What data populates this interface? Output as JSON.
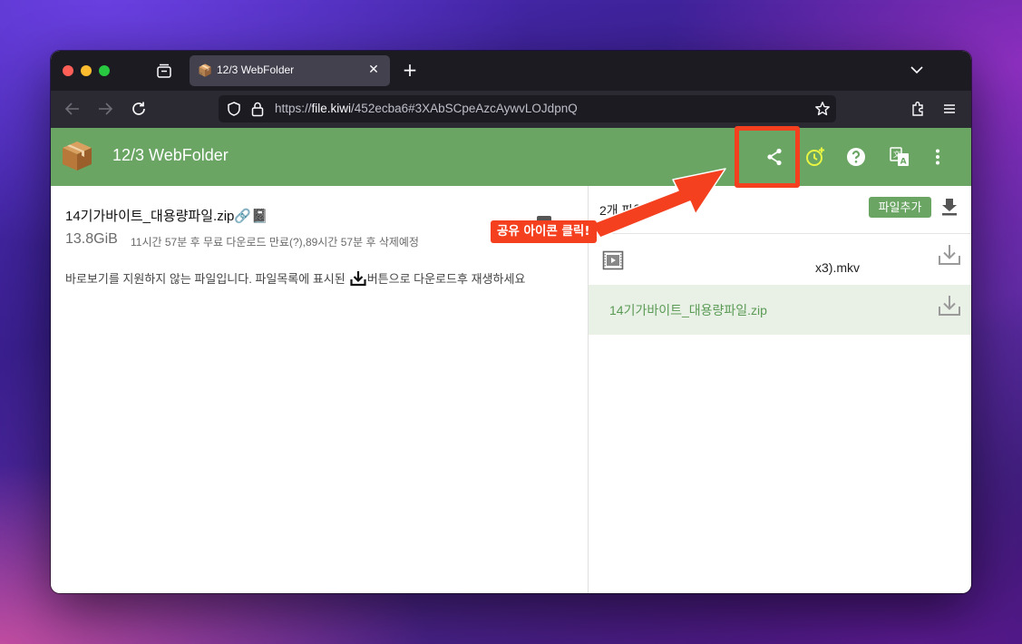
{
  "browser": {
    "tab_title": "12/3 WebFolder",
    "tab_favicon": "package-icon",
    "url_scheme": "https://",
    "url_host": "file.kiwi",
    "url_path": "/452ecba6#3XAbSCpeAzcAywvLOJdpnQ",
    "new_tab_label": "+",
    "close_tab_label": "✕"
  },
  "app": {
    "title": "12/3 WebFolder",
    "accent_color": "#6aa564",
    "header_icons": [
      "share-icon",
      "timer-add-icon",
      "help-icon",
      "translate-icon",
      "more-vert-icon"
    ]
  },
  "file_detail": {
    "name": "14기가바이트_대용량파일.zip🔗📓",
    "size": "13.8GiB",
    "expiry": "11시간 57분 후 무료 다운로드 만료(?),89시간 57분 후 삭제예정",
    "notice_before": "바로보기를 지원하지 않는 파일입니다. 파일목록에 표시된",
    "notice_after": "버튼으로 다운로드후 재생하세요"
  },
  "file_list": {
    "count_label": "2개 파일",
    "add_button": "파일추가",
    "files": [
      {
        "name": "x3).mkv",
        "type": "video",
        "selected": false
      },
      {
        "name": "14기가바이트_대용량파일.zip",
        "type": "zip",
        "selected": true
      }
    ]
  },
  "annotation": {
    "label": "공유 아이콘 클릭!",
    "color": "#f4401f"
  }
}
